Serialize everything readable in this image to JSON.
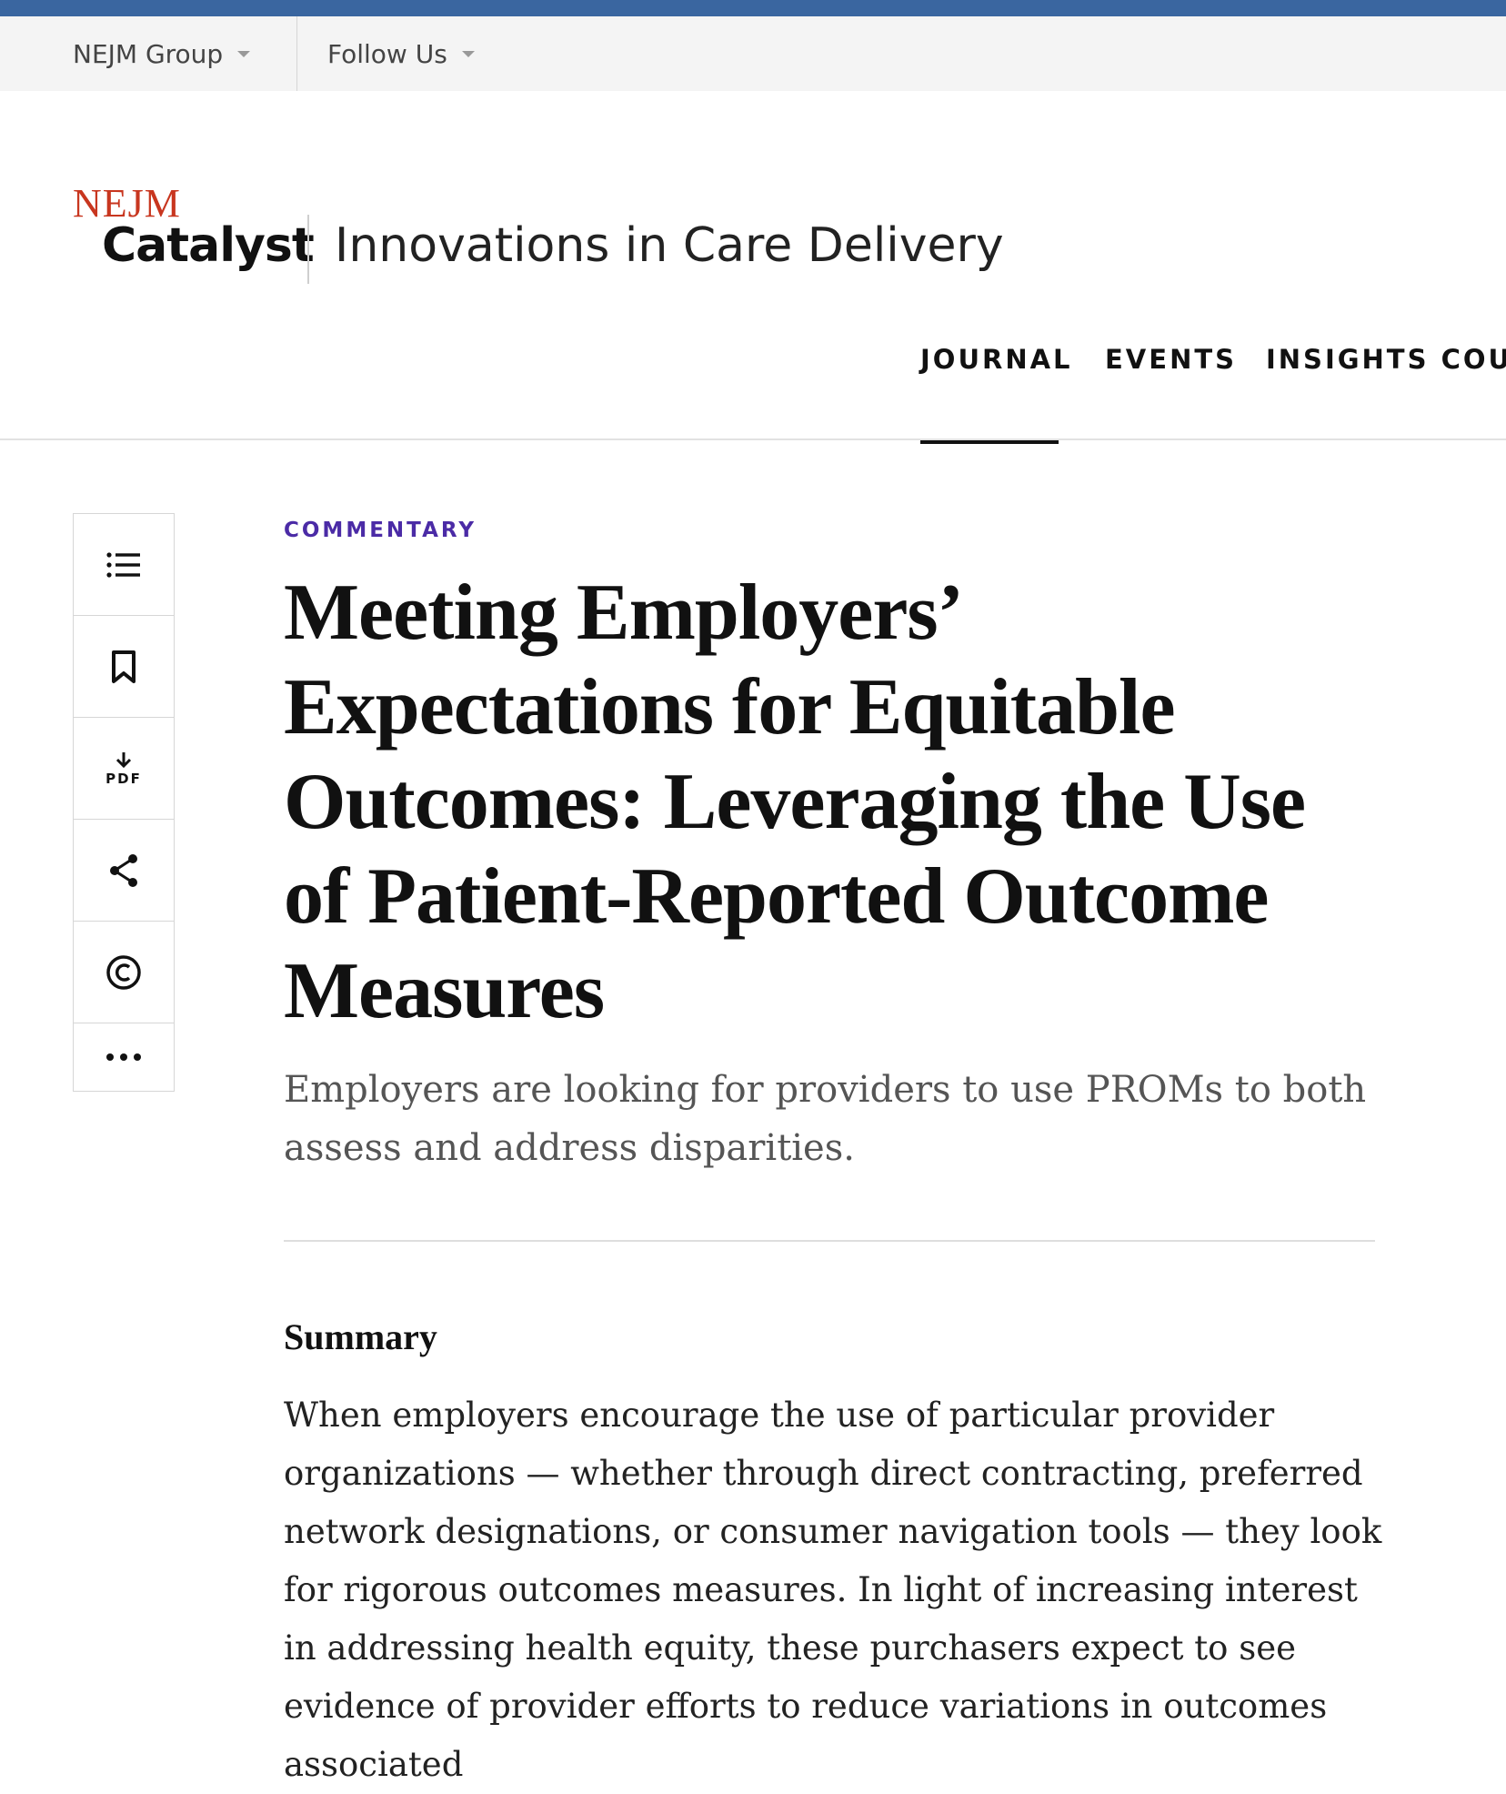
{
  "utility_bar": {
    "group_label": "NEJM Group",
    "follow_label": "Follow Us"
  },
  "brand": {
    "nejm": "NEJM",
    "catalyst": "Catalyst",
    "tagline": "Innovations in Care Delivery"
  },
  "nav": {
    "items": [
      "JOURNAL",
      "EVENTS",
      "INSIGHTS COUN"
    ],
    "active": "JOURNAL"
  },
  "toolbar": {
    "pdf_label": "PDF"
  },
  "article": {
    "kicker": "COMMENTARY",
    "title": "Meeting Employers’ Expectations for Equitable Outcomes: Leveraging the Use of Patient-Reported Outcome Measures",
    "deck": "Employers are looking for providers to use PROMs to both assess and address disparities.",
    "summary_heading": "Summary",
    "summary_text": "When employers encourage the use of particular provider organizations — whether through direct contracting, preferred network designations, or consumer navigation tools — they look for rigorous outcomes measures. In light of increasing interest in addressing health equity, these purchasers expect to see evidence of provider efforts to reduce variations in outcomes associated"
  },
  "colors": {
    "accent_bar": "#3a66a0",
    "brand_red": "#c8361f",
    "kicker_purple": "#4b2ba6"
  }
}
